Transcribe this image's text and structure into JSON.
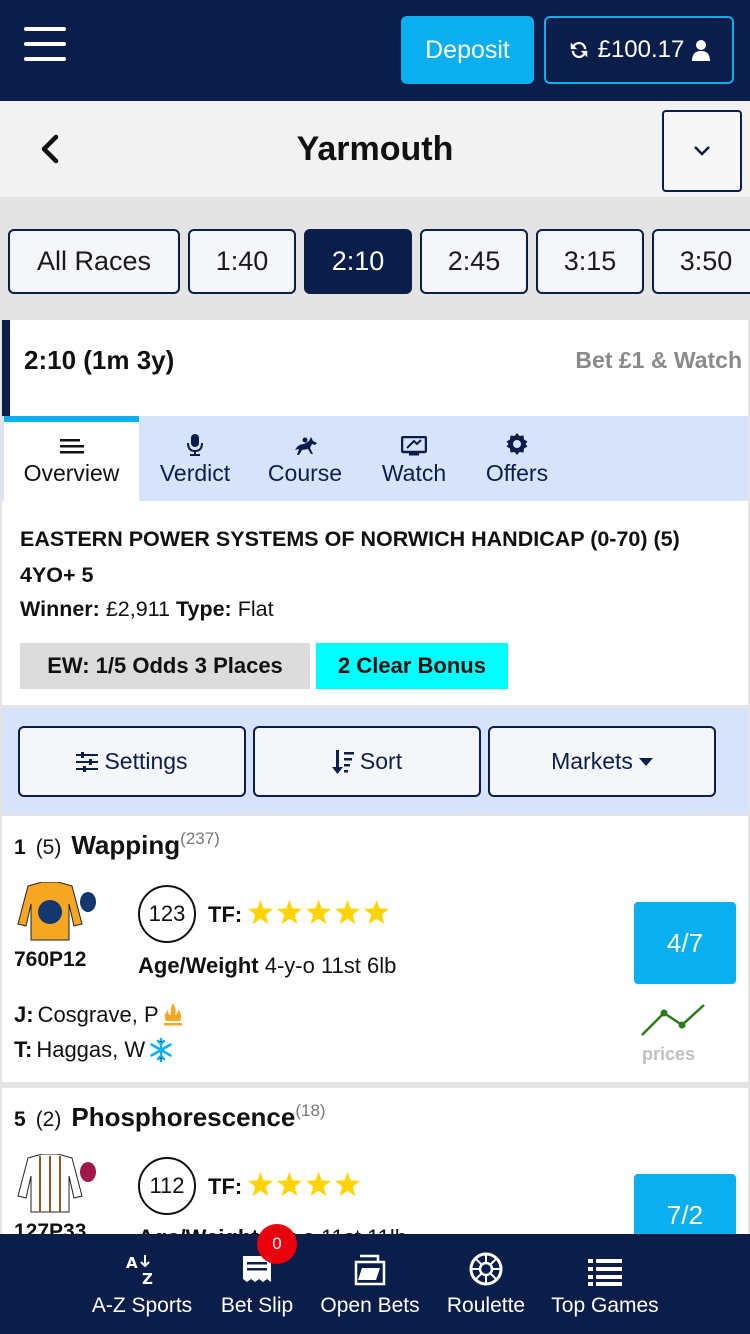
{
  "header": {
    "deposit_label": "Deposit",
    "balance": "£100.17"
  },
  "race_header": {
    "title": "Yarmouth"
  },
  "race_tabs": [
    "All Races",
    "1:40",
    "2:10",
    "2:45",
    "3:15",
    "3:50"
  ],
  "active_race_tab": "2:10",
  "race_card": {
    "time_distance": "2:10 (1m 3y)",
    "bet_watch": "Bet £1 & Watch",
    "tabs": [
      "Overview",
      "Verdict",
      "Course",
      "Watch",
      "Offers"
    ],
    "active_tab": "Overview",
    "race_name": "EASTERN POWER SYSTEMS OF NORWICH HANDICAP (0-70) (5) 4YO+ 5",
    "winner_label": "Winner:",
    "winner_value": "£2,911",
    "type_label": "Type:",
    "type_value": "Flat",
    "ew_terms": "EW: 1/5 Odds 3 Places",
    "bonus": "2 Clear Bonus"
  },
  "controls": {
    "settings": "Settings",
    "sort": "Sort",
    "markets": "Markets"
  },
  "runners": [
    {
      "number": "1",
      "draw": "(5)",
      "name": "Wapping",
      "form_count": "(237)",
      "form": "760P12",
      "rating": "123",
      "tf_label": "TF:",
      "tf_stars": 5,
      "age_weight_label": "Age/Weight",
      "age_weight": "4-y-o 11st 6lb",
      "jockey_label": "J:",
      "jockey": "Cosgrave, P",
      "trainer_label": "T:",
      "trainer": "Haggas, W",
      "odds": "4/7",
      "prices_label": "prices"
    },
    {
      "number": "5",
      "draw": "(2)",
      "name": "Phosphorescence",
      "form_count": "(18)",
      "form": "127P33",
      "rating": "112",
      "tf_label": "TF:",
      "tf_stars": 4,
      "age_weight_label": "Age/Weight",
      "age_weight": "4-y-o 11st 11lb",
      "odds": "7/2"
    }
  ],
  "bottom_nav": {
    "items": [
      "A-Z Sports",
      "Bet Slip",
      "Open Bets",
      "Roulette",
      "Top Games"
    ],
    "bet_slip_count": "0"
  },
  "colors": {
    "navy": "#0b1e4a",
    "accent_blue": "#0aaff0",
    "bonus_cyan": "#00ffff",
    "star_yellow": "#ffd400",
    "badge_red": "#e8000c"
  }
}
